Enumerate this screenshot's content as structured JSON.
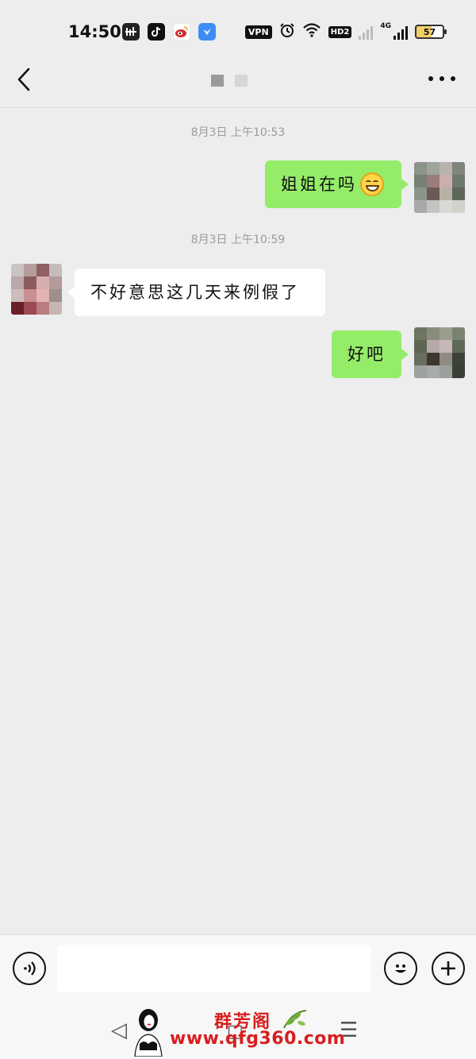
{
  "status_bar": {
    "time": "14:50",
    "vpn_label": "VPN",
    "hd_label": "HD2",
    "network_label": "4G",
    "battery_level": "57",
    "app_icons": [
      "music-app-icon",
      "tiktok-icon",
      "weibo-icon",
      "feishu-icon"
    ]
  },
  "header": {
    "back_icon": "chevron-left-icon",
    "more_icon": "more-dots-icon"
  },
  "messages": [
    {
      "type": "timestamp",
      "text": "8月3日 上午10:53"
    },
    {
      "type": "outgoing",
      "text": "姐姐在吗",
      "emoji": "grinning-face-emoji"
    },
    {
      "type": "timestamp",
      "text": "8月3日 上午10:59"
    },
    {
      "type": "incoming",
      "text": "不好意思这几天来例假了"
    },
    {
      "type": "outgoing",
      "text": "好吧"
    }
  ],
  "input_bar": {
    "voice_icon": "voice-icon",
    "emoji_icon": "emoji-icon",
    "add_icon": "plus-icon",
    "input_value": ""
  },
  "watermark": {
    "brand": "群芳阁",
    "site": "www.qfg360.com"
  },
  "colors": {
    "background": "#ededed",
    "outgoing_bubble": "#95ec69",
    "incoming_bubble": "#ffffff",
    "watermark": "#d81e1e"
  }
}
